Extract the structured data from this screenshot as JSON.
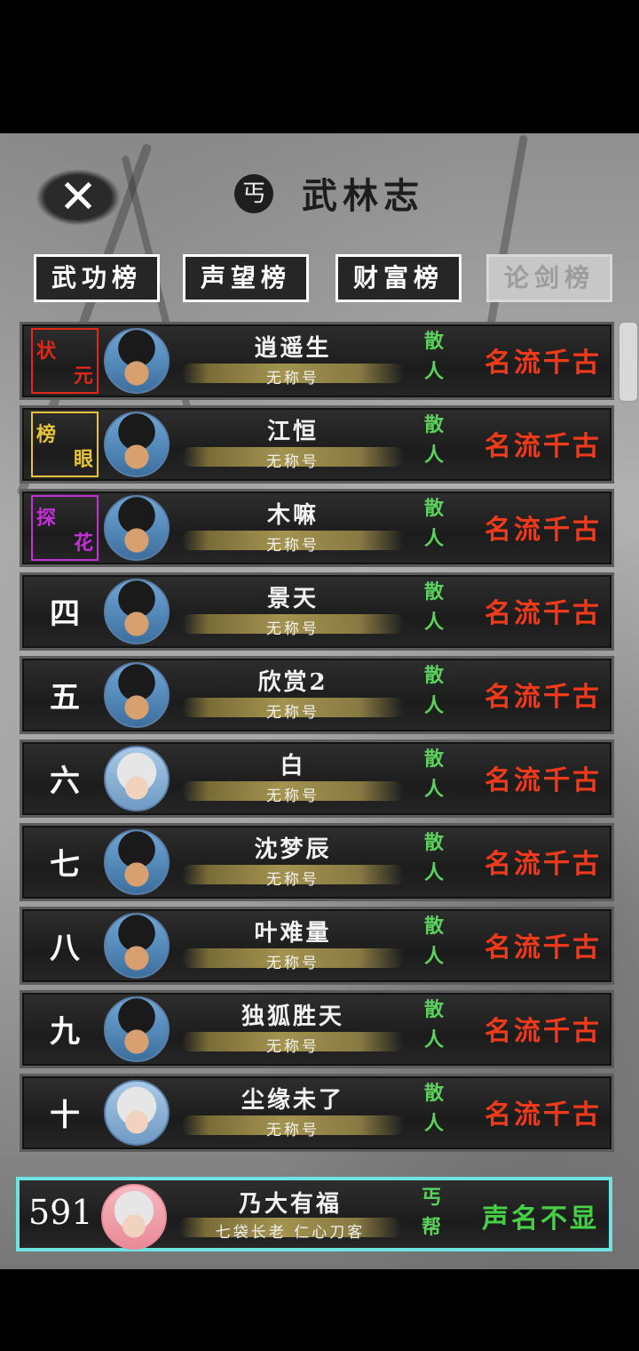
{
  "header": {
    "title": "武林志",
    "emblem": "丐",
    "close": "✕"
  },
  "tabs": [
    {
      "label": "武功榜",
      "disabled": false
    },
    {
      "label": "声望榜",
      "disabled": false
    },
    {
      "label": "财富榜",
      "disabled": false
    },
    {
      "label": "论剑榜",
      "disabled": true
    }
  ],
  "rows": [
    {
      "rank_a": "状",
      "rank_b": "元",
      "badge_color": "#e0281a",
      "name": "逍遥生",
      "title": "无称号",
      "faction": [
        "散",
        "人"
      ],
      "fame": "名流千古",
      "avatar": "dark"
    },
    {
      "rank_a": "榜",
      "rank_b": "眼",
      "badge_color": "#e5c43a",
      "name": "江恒",
      "title": "无称号",
      "faction": [
        "散",
        "人"
      ],
      "fame": "名流千古",
      "avatar": "dark"
    },
    {
      "rank_a": "探",
      "rank_b": "花",
      "badge_color": "#c331d6",
      "name": "木嘛",
      "title": "无称号",
      "faction": [
        "散",
        "人"
      ],
      "fame": "名流千古",
      "avatar": "dark"
    },
    {
      "rank": "四",
      "name": "景天",
      "title": "无称号",
      "faction": [
        "散",
        "人"
      ],
      "fame": "名流千古",
      "avatar": "dark"
    },
    {
      "rank": "五",
      "name": "欣赏2",
      "title": "无称号",
      "faction": [
        "散",
        "人"
      ],
      "fame": "名流千古",
      "avatar": "dark"
    },
    {
      "rank": "六",
      "name": "白",
      "title": "无称号",
      "faction": [
        "散",
        "人"
      ],
      "fame": "名流千古",
      "avatar": "pale"
    },
    {
      "rank": "七",
      "name": "沈梦辰",
      "title": "无称号",
      "faction": [
        "散",
        "人"
      ],
      "fame": "名流千古",
      "avatar": "dark"
    },
    {
      "rank": "八",
      "name": "叶难量",
      "title": "无称号",
      "faction": [
        "散",
        "人"
      ],
      "fame": "名流千古",
      "avatar": "dark"
    },
    {
      "rank": "九",
      "name": "独狐胜天",
      "title": "无称号",
      "faction": [
        "散",
        "人"
      ],
      "fame": "名流千古",
      "avatar": "dark"
    },
    {
      "rank": "十",
      "name": "尘缘未了",
      "title": "无称号",
      "faction": [
        "散",
        "人"
      ],
      "fame": "名流千古",
      "avatar": "pale"
    }
  ],
  "self": {
    "rank": "591",
    "name": "乃大有福",
    "title": "七袋长老 仁心刀客",
    "faction": [
      "丐",
      "帮"
    ],
    "fame": "声名不显",
    "fame_color": "#46d046"
  },
  "colors": {
    "fame": "#f03a1a",
    "faction": "#5bd25b",
    "self_border": "#6ee3e3"
  }
}
